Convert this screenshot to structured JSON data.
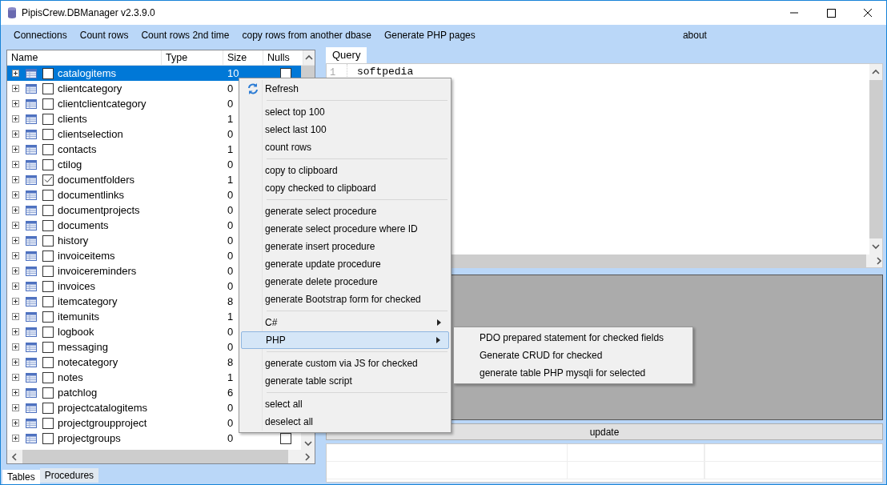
{
  "window": {
    "title": "PipisCrew.DBManager v2.3.9.0"
  },
  "menu_bar": {
    "items": [
      "Connections",
      "Count rows",
      "Count rows 2nd time",
      "copy rows from another dbase",
      "Generate PHP pages"
    ],
    "right_item": "about"
  },
  "tree": {
    "columns": [
      "Name",
      "Type",
      "Size",
      "Nulls"
    ],
    "rows": [
      {
        "name": "catalogitems",
        "size": "10",
        "checked": false,
        "selected": true,
        "nulls_checked": false
      },
      {
        "name": "clientcategory",
        "size": "0",
        "checked": false,
        "selected": false
      },
      {
        "name": "clientclientcategory",
        "size": "0",
        "checked": false,
        "selected": false
      },
      {
        "name": "clients",
        "size": "1",
        "checked": false,
        "selected": false
      },
      {
        "name": "clientselection",
        "size": "0",
        "checked": false,
        "selected": false
      },
      {
        "name": "contacts",
        "size": "1",
        "checked": false,
        "selected": false
      },
      {
        "name": "ctilog",
        "size": "0",
        "checked": false,
        "selected": false
      },
      {
        "name": "documentfolders",
        "size": "1",
        "checked": true,
        "selected": false
      },
      {
        "name": "documentlinks",
        "size": "0",
        "checked": false,
        "selected": false
      },
      {
        "name": "documentprojects",
        "size": "0",
        "checked": false,
        "selected": false
      },
      {
        "name": "documents",
        "size": "0",
        "checked": false,
        "selected": false
      },
      {
        "name": "history",
        "size": "0",
        "checked": false,
        "selected": false
      },
      {
        "name": "invoiceitems",
        "size": "0",
        "checked": false,
        "selected": false
      },
      {
        "name": "invoicereminders",
        "size": "0",
        "checked": false,
        "selected": false
      },
      {
        "name": "invoices",
        "size": "0",
        "checked": false,
        "selected": false
      },
      {
        "name": "itemcategory",
        "size": "8",
        "checked": false,
        "selected": false
      },
      {
        "name": "itemunits",
        "size": "1",
        "checked": false,
        "selected": false
      },
      {
        "name": "logbook",
        "size": "0",
        "checked": false,
        "selected": false
      },
      {
        "name": "messaging",
        "size": "0",
        "checked": false,
        "selected": false
      },
      {
        "name": "notecategory",
        "size": "8",
        "checked": false,
        "selected": false
      },
      {
        "name": "notes",
        "size": "1",
        "checked": false,
        "selected": false
      },
      {
        "name": "patchlog",
        "size": "6",
        "checked": false,
        "selected": false
      },
      {
        "name": "projectcatalogitems",
        "size": "0",
        "checked": false,
        "selected": false
      },
      {
        "name": "projectgroupproject",
        "size": "0",
        "checked": false,
        "selected": false
      },
      {
        "name": "projectgroups",
        "size": "0",
        "checked": false,
        "selected": false,
        "nulls_checked": false
      }
    ]
  },
  "bottom_tabs": [
    {
      "label": "Tables",
      "selected": true
    },
    {
      "label": "Procedures",
      "selected": false
    }
  ],
  "query_tab": {
    "label": "Query"
  },
  "editor": {
    "line_numbers": [
      "1"
    ],
    "lines": [
      "softpedia"
    ]
  },
  "update_button": "update",
  "context_menu": {
    "items": [
      {
        "kind": "item",
        "label": "Refresh",
        "icon": true
      },
      {
        "kind": "separator"
      },
      {
        "kind": "item",
        "label": "select top 100"
      },
      {
        "kind": "item",
        "label": "select last 100"
      },
      {
        "kind": "item",
        "label": "count rows"
      },
      {
        "kind": "separator"
      },
      {
        "kind": "item",
        "label": "copy to clipboard"
      },
      {
        "kind": "item",
        "label": "copy checked to clipboard"
      },
      {
        "kind": "separator"
      },
      {
        "kind": "item",
        "label": "generate select procedure"
      },
      {
        "kind": "item",
        "label": "generate select procedure where ID"
      },
      {
        "kind": "item",
        "label": "generate insert procedure"
      },
      {
        "kind": "item",
        "label": "generate update procedure"
      },
      {
        "kind": "item",
        "label": "generate delete procedure"
      },
      {
        "kind": "item",
        "label": "generate Bootstrap form for checked"
      },
      {
        "kind": "separator"
      },
      {
        "kind": "submenu",
        "label": "C#",
        "selected": false
      },
      {
        "kind": "submenu",
        "label": "PHP",
        "selected": true
      },
      {
        "kind": "separator"
      },
      {
        "kind": "item",
        "label": "generate custom via JS for checked"
      },
      {
        "kind": "item",
        "label": "generate table script"
      },
      {
        "kind": "separator"
      },
      {
        "kind": "item",
        "label": "select all"
      },
      {
        "kind": "item",
        "label": "deselect all"
      }
    ]
  },
  "submenu": {
    "items": [
      "PDO prepared statement for checked fields",
      "Generate CRUD for checked",
      "generate table PHP mysqli for selected"
    ]
  }
}
